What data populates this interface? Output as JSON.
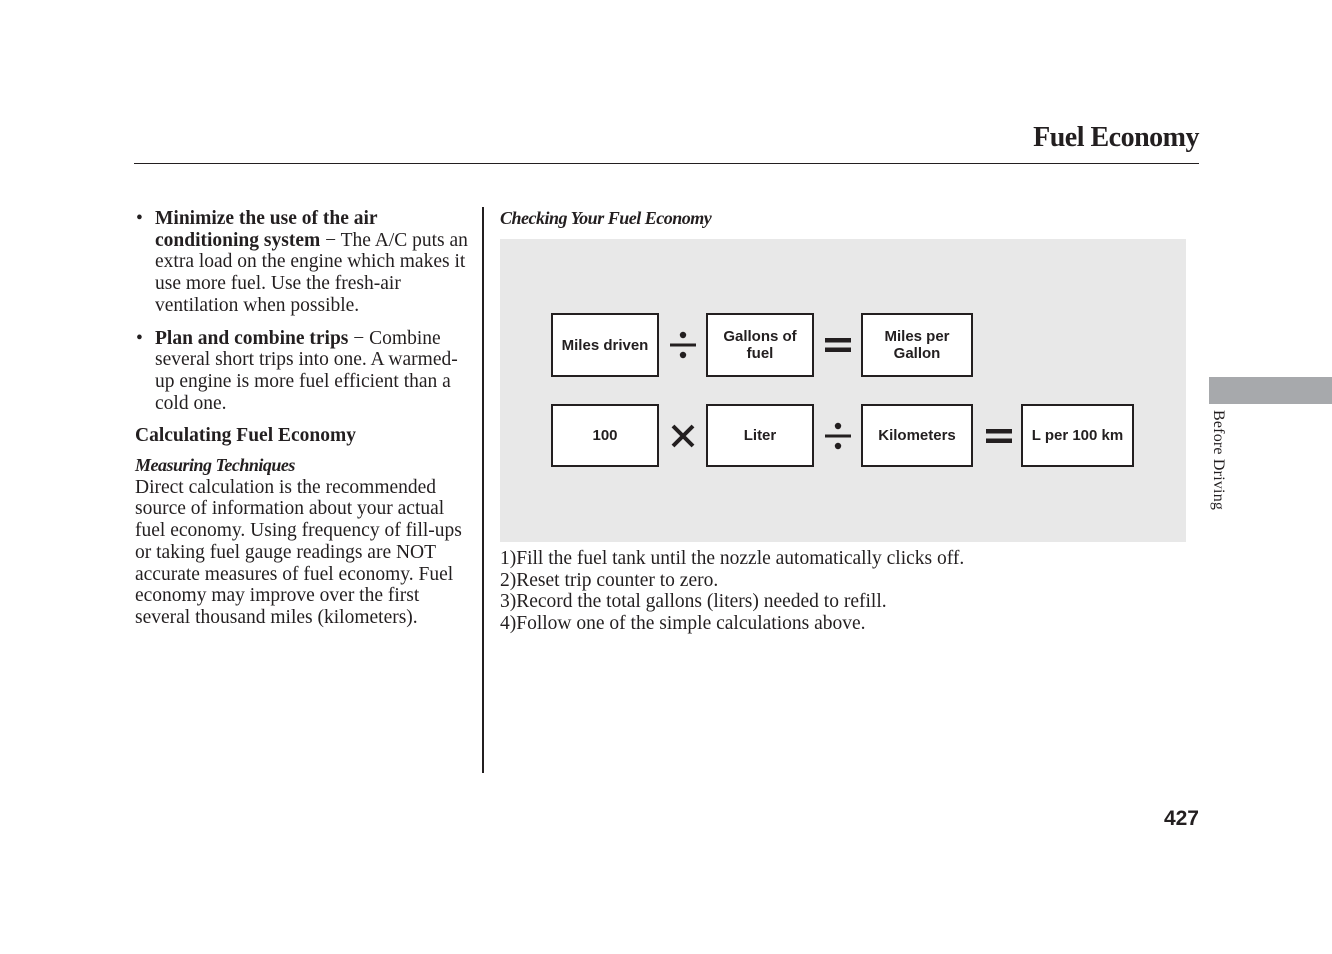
{
  "header": {
    "title": "Fuel Economy"
  },
  "left_column": {
    "bullets": [
      {
        "title": "Minimize the use of the air conditioning system",
        "separator": "−",
        "text": "The A/C puts an extra load on the engine which makes it use more fuel. Use the fresh-air ventilation when possible."
      },
      {
        "title": "Plan and combine trips",
        "separator": "−",
        "text": "Combine several short trips into one. A warmed-up engine is more fuel efficient than a cold one."
      }
    ],
    "section_heading": "Calculating Fuel Economy",
    "subheading": "Measuring Techniques",
    "paragraph": "Direct calculation is the recommended source of information about your actual fuel economy. Using frequency of fill-ups or taking fuel gauge readings are NOT accurate measures of fuel economy. Fuel economy may improve over the first several thousand miles (kilometers)."
  },
  "right_column": {
    "heading": "Checking Your Fuel Economy",
    "diagram": {
      "row1": {
        "operand1": "Miles driven",
        "operator1": "divide-icon",
        "operand2": "Gallons of fuel",
        "operator2": "equals-icon",
        "result": "Miles per Gallon"
      },
      "row2": {
        "operand1": "100",
        "operator1": "multiply-icon",
        "operand2": "Liter",
        "operator2": "divide-icon",
        "operand3": "Kilometers",
        "operator3": "equals-icon",
        "result": "L per 100 km"
      }
    },
    "steps": [
      "1)Fill the fuel tank until the nozzle automatically clicks off.",
      "2)Reset trip counter to zero.",
      "3)Record the total gallons (liters) needed to refill.",
      "4)Follow one of the simple calculations above."
    ]
  },
  "side_tab": {
    "label": "Before Driving"
  },
  "footer": {
    "page_number": "427"
  }
}
